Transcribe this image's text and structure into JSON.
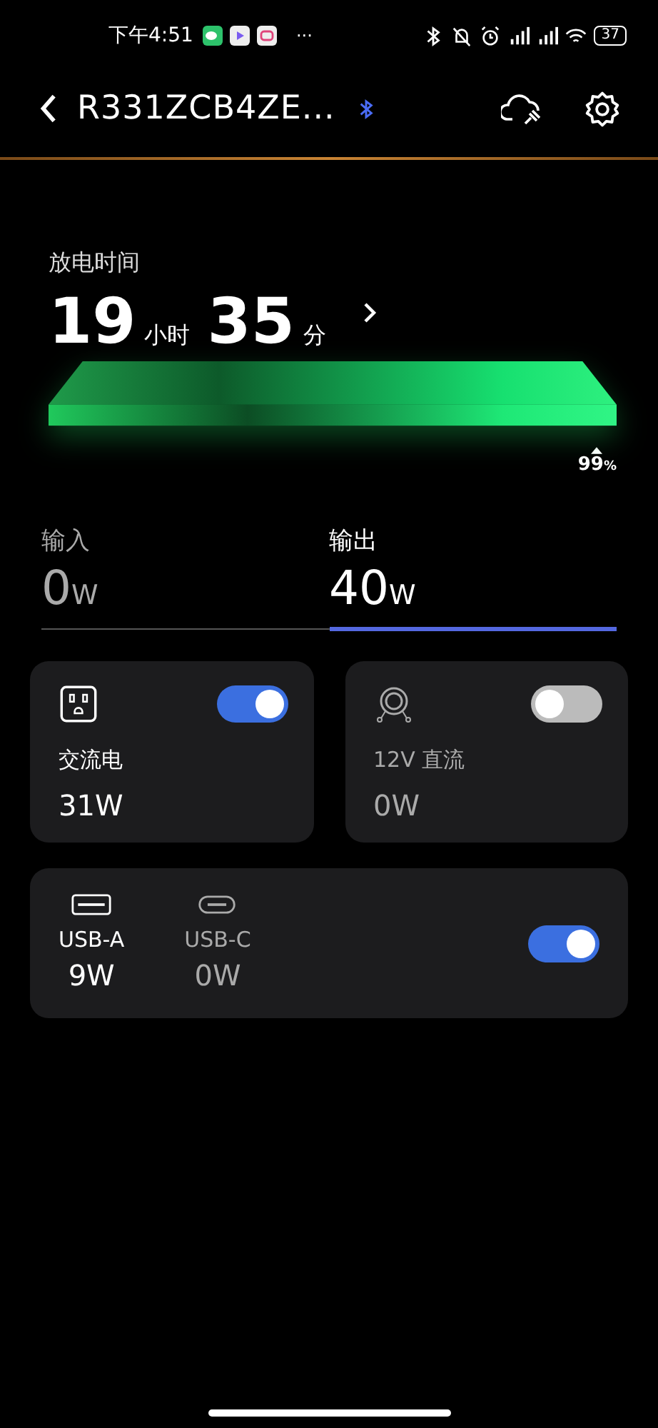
{
  "status_bar": {
    "time": "下午4:51",
    "more": "···",
    "battery": "37"
  },
  "header": {
    "title": "R331ZCB4ZE..."
  },
  "discharge": {
    "label": "放电时间",
    "hours": "19",
    "hours_unit": "小时",
    "minutes": "35",
    "minutes_unit": "分",
    "percent": "99",
    "percent_unit": "%"
  },
  "tabs": [
    {
      "label": "输入",
      "value": "0",
      "unit": "W",
      "selected": false
    },
    {
      "label": "输出",
      "value": "40",
      "unit": "W",
      "selected": true
    }
  ],
  "outputs": [
    {
      "kind": "ac",
      "label": "交流电",
      "value": "31W",
      "on": true
    },
    {
      "kind": "dc",
      "label": "12V 直流",
      "value": "0W",
      "on": false
    }
  ],
  "usb": {
    "on": true,
    "ports": [
      {
        "kind": "usb-a",
        "label": "USB-A",
        "value": "9W",
        "active": true
      },
      {
        "kind": "usb-c",
        "label": "USB-C",
        "value": "0W",
        "active": false
      }
    ]
  }
}
